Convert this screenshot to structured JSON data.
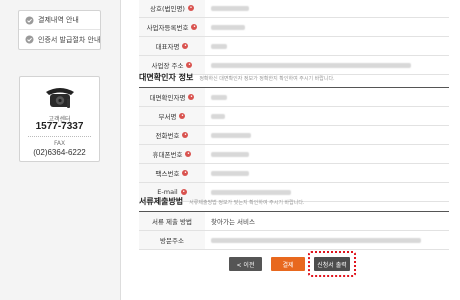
{
  "sidebar": {
    "menu": [
      {
        "label": "결제내역 안내",
        "icon": "check-circle-icon"
      },
      {
        "label": "인증서 발급절차 안내",
        "icon": "check-circle-icon"
      }
    ],
    "cs": {
      "label": "고객센터",
      "number": "1577-7337",
      "fax_label": "FAX",
      "fax": "(02)6364-6222"
    }
  },
  "company_info": {
    "rows": [
      {
        "label": "상호(법인명)",
        "required": true
      },
      {
        "label": "사업자등록번호",
        "required": true
      },
      {
        "label": "대표자명",
        "required": true
      },
      {
        "label": "사업장 주소",
        "required": true
      }
    ]
  },
  "contact": {
    "title": "대면확인자 정보",
    "hint": "정확하신 대면확인자 정보가 정확한지 확인하여 주시기 바랍니다.",
    "rows": [
      {
        "label": "대면확인자명",
        "required": true
      },
      {
        "label": "부서명",
        "required": true
      },
      {
        "label": "전화번호",
        "required": true
      },
      {
        "label": "휴대폰번호",
        "required": true
      },
      {
        "label": "팩스번호",
        "required": true
      },
      {
        "label": "E-mail",
        "required": true
      }
    ]
  },
  "document": {
    "title": "서류제출방법",
    "hint": "서류제출방법 정보가 맞는지 확인하여 주시기 바랍니다.",
    "rows": [
      {
        "label": "서류 제출 방법",
        "value": "찾아가는 서비스"
      },
      {
        "label": "방문주소",
        "value": ""
      }
    ]
  },
  "buttons": {
    "prev": "< 이전",
    "pay": "결제",
    "print": "신청서 출력"
  },
  "colors": {
    "accent": "#e8681e",
    "required_dot": "#d9534f",
    "highlight": "#e0141e"
  }
}
